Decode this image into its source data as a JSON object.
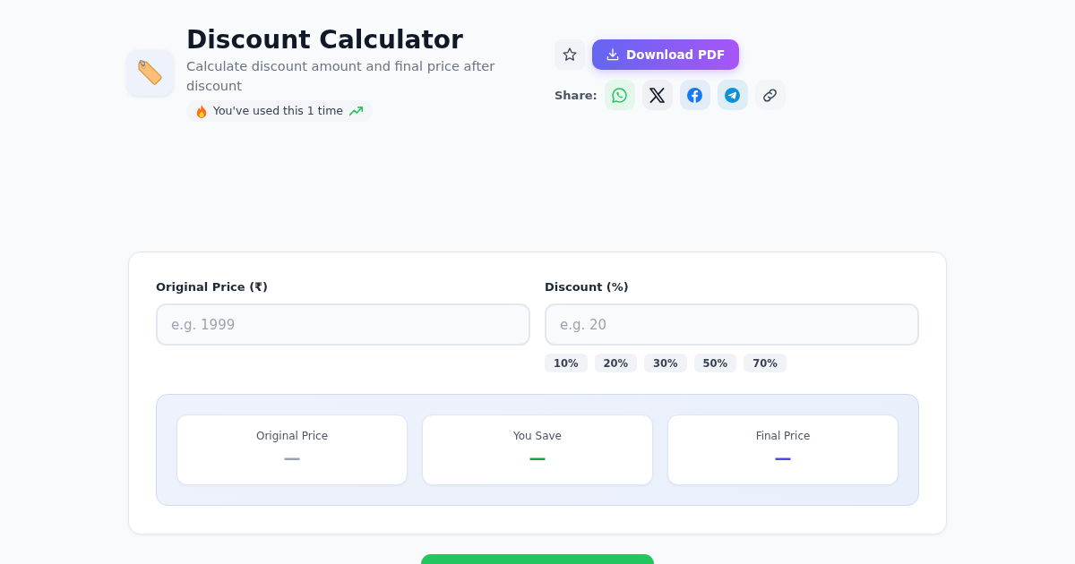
{
  "header": {
    "title": "Discount Calculator",
    "subtitle": "Calculate discount amount and final price after discount",
    "usage_badge": "You've used this 1 time"
  },
  "actions": {
    "download_button": "Download PDF",
    "share_label": "Share:"
  },
  "form": {
    "fields": [
      {
        "label": "Original Price (₹)",
        "placeholder": "e.g. 1999"
      },
      {
        "label": "Discount (%)",
        "placeholder": "e.g. 20",
        "presets": [
          "10%",
          "20%",
          "30%",
          "50%",
          "70%"
        ]
      }
    ]
  },
  "results": [
    {
      "label": "Original Price",
      "value": "—",
      "color": "#9ca3af"
    },
    {
      "label": "You Save",
      "value": "—",
      "color": "#16a34a"
    },
    {
      "label": "Final Price",
      "value": "—",
      "color": "#4f46e5"
    }
  ]
}
